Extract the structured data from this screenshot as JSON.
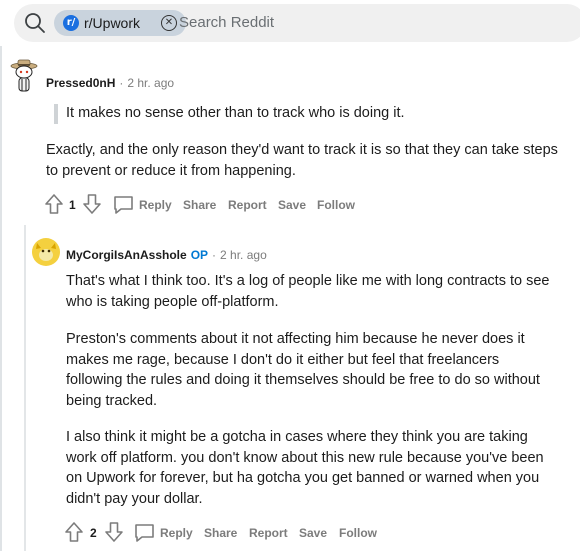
{
  "search": {
    "chip_icon_letter": "r/",
    "chip_label": "r/Upwork",
    "placeholder": "Search Reddit"
  },
  "comments": [
    {
      "username": "Pressed0nH",
      "time": "2 hr. ago",
      "quote": "It makes no sense other than to track who is doing it.",
      "paragraphs": [
        "Exactly, and the only reason they'd want to track it is so that they can take steps to prevent or reduce it from happening."
      ],
      "votes": "1"
    },
    {
      "username": "MyCorgiIsAnAsshole",
      "op": "OP",
      "time": "2 hr. ago",
      "paragraphs": [
        "That's what I think too. It's a log of people like me with long contracts to see who is taking people off-platform.",
        "Preston's comments about it not affecting him because he never does it makes me rage, because I don't do it either but feel that freelancers following the rules and doing it themselves should be free to do so without being tracked.",
        "I also think it might be a gotcha in cases where they think you are taking work off platform. you don't know about this new rule because you've been on Upwork for forever, but ha gotcha you get banned or warned when you didn't pay your dollar."
      ],
      "votes": "2"
    }
  ],
  "actions": {
    "reply": "Reply",
    "share": "Share",
    "report": "Report",
    "save": "Save",
    "follow": "Follow"
  },
  "separator": "·"
}
